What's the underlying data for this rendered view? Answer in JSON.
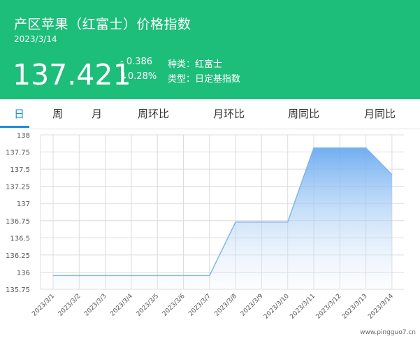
{
  "header": {
    "title": "产区苹果（红富士）价格指数",
    "date": "2023/3/14",
    "price": "137.421",
    "change": "- 0.386",
    "change_pct": "↓0.28%",
    "variety": "种类：红富士",
    "type": "类型：日定基指数"
  },
  "tabs": [
    {
      "label": "日",
      "active": true
    },
    {
      "label": "周"
    },
    {
      "label": "月"
    },
    {
      "label": "周环比"
    },
    {
      "label": "月环比"
    },
    {
      "label": "周同比"
    },
    {
      "label": "月同比"
    }
  ],
  "watermark": "www.pingguo7.cn",
  "colors": {
    "header_bg": "#1dbd7a",
    "accent": "#1a8fd8",
    "line": "#7fb6e8"
  },
  "chart_data": {
    "type": "area",
    "x": [
      "2023/3/1",
      "2023/3/2",
      "2023/3/3",
      "2023/3/4",
      "2023/3/5",
      "2023/3/6",
      "2023/3/7",
      "2023/3/8",
      "2023/3/9",
      "2023/3/10",
      "2023/3/11",
      "2023/3/12",
      "2023/3/13",
      "2023/3/14"
    ],
    "values": [
      135.95,
      135.95,
      135.95,
      135.95,
      135.95,
      135.95,
      135.95,
      136.73,
      136.73,
      136.73,
      137.81,
      137.81,
      137.81,
      137.42
    ],
    "yticks": [
      "138",
      "137.75",
      "137.5",
      "137.25",
      "137",
      "136.75",
      "136.5",
      "136.25",
      "136",
      "135.75"
    ],
    "ylim": [
      135.75,
      138
    ],
    "grid": true,
    "xlabel": "",
    "ylabel": ""
  }
}
